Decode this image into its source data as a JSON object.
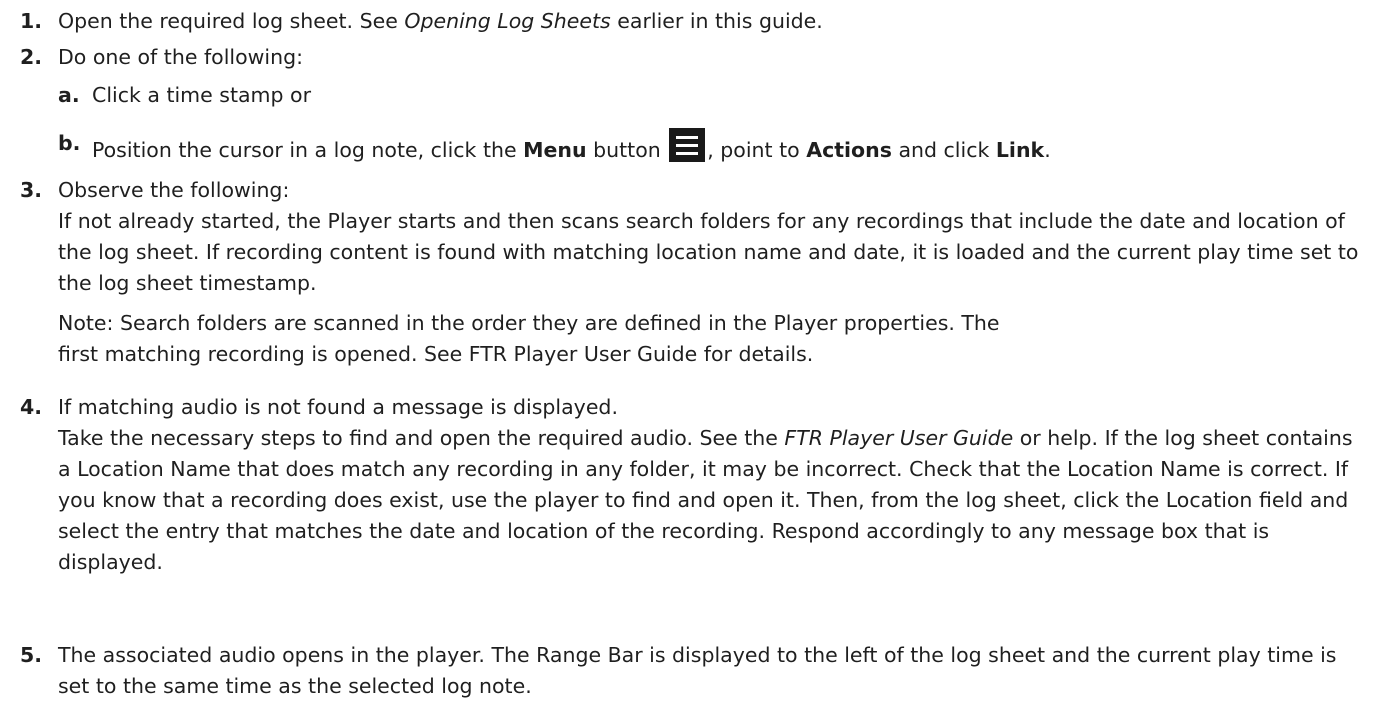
{
  "steps": [
    {
      "num": "1.",
      "pre": "Open the required log sheet.  See ",
      "em": "Opening Log Sheets",
      "post": " earlier in this guide."
    },
    {
      "num": "2.",
      "text": "Do one of the following:",
      "subs": [
        {
          "num": "a.",
          "text": "Click a time stamp or"
        },
        {
          "num": "b.",
          "t1": "Position the cursor in a log note, click the ",
          "b1": "Menu",
          "t2": " button ",
          "t3": ", point to ",
          "b2": "Actions",
          "t4": " and click ",
          "b3": "Link",
          "t5": ".",
          "icon": "menu-hamburger-icon"
        }
      ]
    },
    {
      "num": "3.",
      "text": "Observe the following:",
      "detail": "If not already started, the Player starts and then scans search folders for any recordings that include the date and location of the log sheet.  If recording content is found with matching location name and date, it is loaded and the current play time set to the log sheet timestamp.",
      "note_line1": "Note:  Search folders are scanned in the order they are defined in the Player properties.  The",
      "note_line2": "first matching recording is opened.  See FTR Player User Guide for details."
    },
    {
      "num": "4.",
      "text": "If matching audio is not found a message is displayed.",
      "d1": "Take the necessary steps to find and open the required audio.  See the ",
      "em": "FTR Player User Guide",
      "d2": " or help.  If the log sheet contains a Location Name that does match any recording in any folder, it may be incorrect.  Check that the Location Name is correct.  If you know that a recording does exist, use the player to find and open it.  Then, from the log sheet, click the Location field and select the entry that matches the date and location of the recording.  Respond accordingly to any message box that is displayed."
    },
    {
      "num": "5.",
      "text": "The associated audio opens in the player.  The Range Bar is displayed to the left of the log sheet and the current play time is set to the same time as the selected log note."
    }
  ]
}
